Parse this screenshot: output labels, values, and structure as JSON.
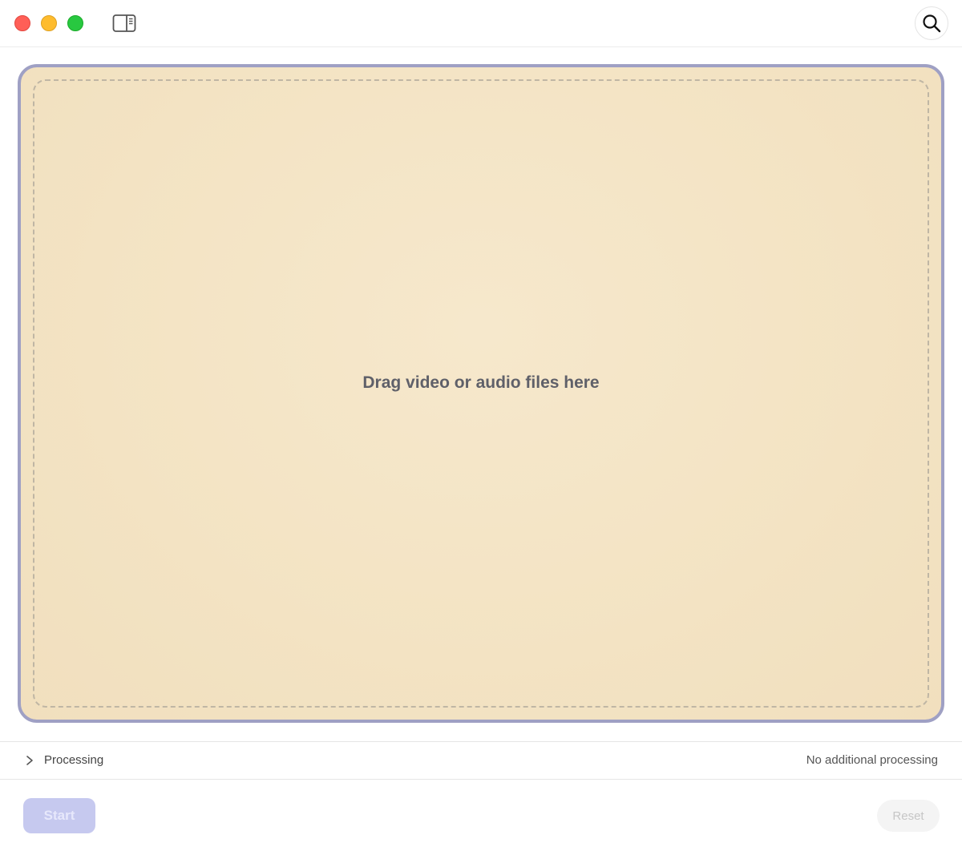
{
  "window": {
    "controls": [
      "close",
      "minimize",
      "maximize"
    ],
    "colors": {
      "close": "#ff5f57",
      "minimize": "#febc2e",
      "maximize": "#28c840"
    }
  },
  "toolbar": {
    "sidebar_toggle_icon": "sidebar-right-icon",
    "search_icon": "magnifying-glass-icon"
  },
  "dropzone": {
    "text": "Drag video or audio files here",
    "border_color": "#9fa0c4",
    "background_color": "#f3e3c3"
  },
  "processing": {
    "label": "Processing",
    "status": "No additional processing",
    "expander_icon": "chevron-right-icon"
  },
  "actions": {
    "start_label": "Start",
    "reset_label": "Reset",
    "start_color": "#c6c9ef"
  }
}
